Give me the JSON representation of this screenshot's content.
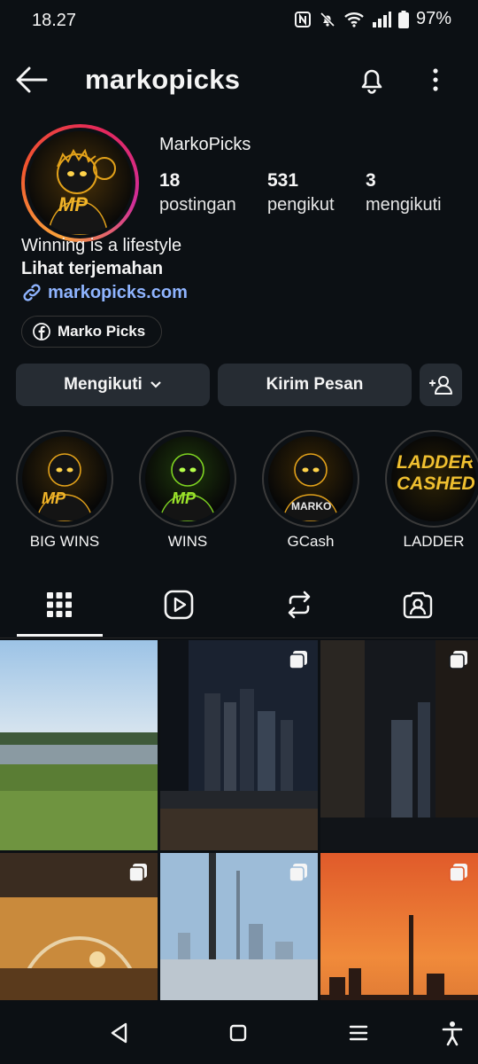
{
  "status": {
    "time": "18.27",
    "battery": "97%"
  },
  "header": {
    "username": "markopicks"
  },
  "profile": {
    "full_name": "MarkoPicks",
    "avatar_text": "MP",
    "stats": [
      {
        "value": "18",
        "label": "postingan"
      },
      {
        "value": "531",
        "label": "pengikut"
      },
      {
        "value": "3",
        "label": "mengikuti"
      }
    ],
    "bio_line": "Winning is a lifestyle",
    "translate": "Lihat terjemahan",
    "link": "markopicks.com",
    "facebook_chip": "Marko Picks"
  },
  "actions": {
    "following": "Mengikuti",
    "message": "Kirim Pesan"
  },
  "highlights": [
    {
      "label": "BIG WINS",
      "badge": "MP"
    },
    {
      "label": "WINS",
      "badge": "MP"
    },
    {
      "label": "GCash",
      "badge": "MARKO"
    },
    {
      "label": "LADDER",
      "badge": "LADDER CASHED"
    }
  ],
  "colors": {
    "background": "#0c1014",
    "button": "#262c33",
    "link": "#8fb4ff",
    "accent_gold": "#e3a21a"
  }
}
